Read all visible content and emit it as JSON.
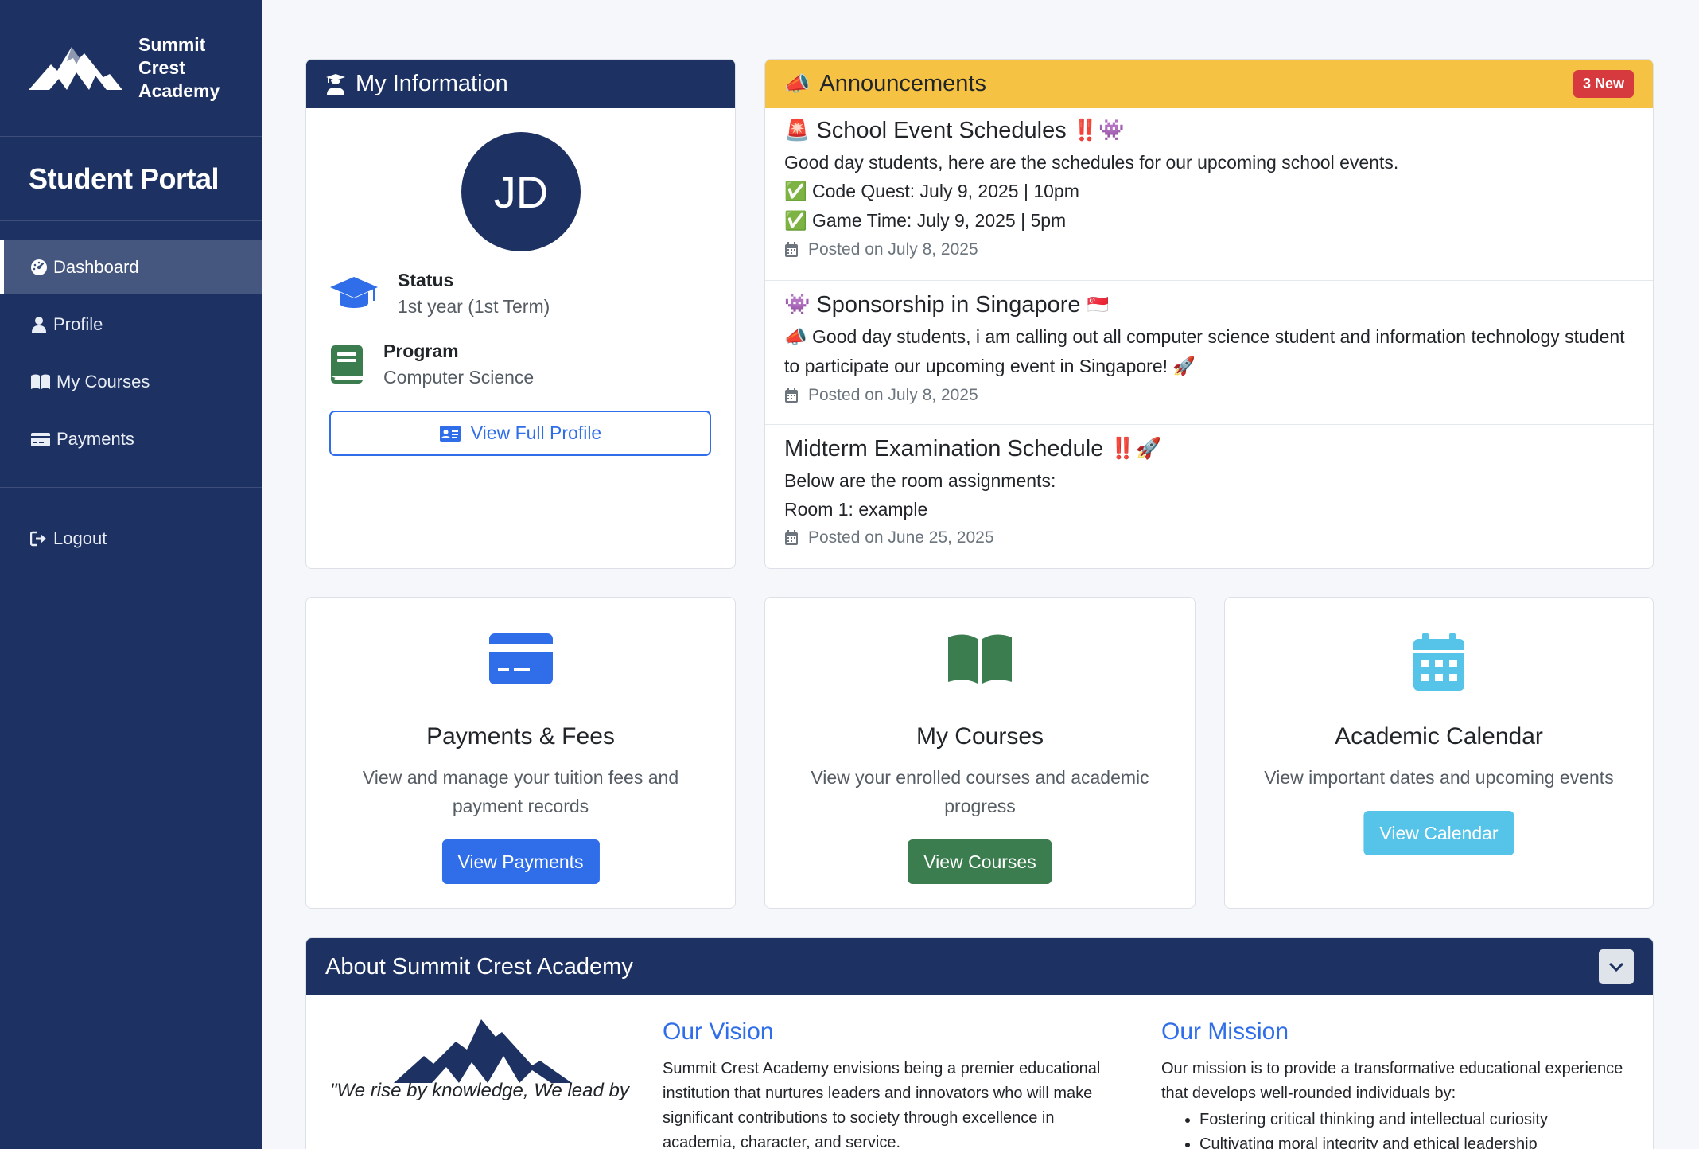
{
  "sidebar": {
    "brand_name": "Summit Crest Academy",
    "portal_title": "Student Portal",
    "items": [
      {
        "label": "Dashboard",
        "icon": "dashboard-icon"
      },
      {
        "label": "Profile",
        "icon": "user-icon"
      },
      {
        "label": "My Courses",
        "icon": "book-icon"
      },
      {
        "label": "Payments",
        "icon": "credit-card-icon"
      }
    ],
    "logout_label": "Logout"
  },
  "info_card": {
    "title": "My Information",
    "avatar_initials": "JD",
    "status_label": "Status",
    "status_value": "1st year (1st Term)",
    "program_label": "Program",
    "program_value": "Computer Science",
    "button_label": "View Full Profile"
  },
  "announcements": {
    "title": "Announcements",
    "badge": "3 New",
    "items": [
      {
        "title": "School Event Schedules",
        "title_prefix": "🚨",
        "title_suffix": "‼️👾",
        "body": "Good day students, here are the schedules for our upcoming school events.",
        "line1": "Code Quest: July 9, 2025 | 10pm",
        "line2": "Game Time: July 9, 2025 | 5pm",
        "line_icon": "✅",
        "date": "Posted on July 8, 2025"
      },
      {
        "title": "Sponsorship in Singapore",
        "title_prefix": "👾",
        "title_suffix": "🇸🇬",
        "body_prefix": "📣",
        "body": "Good day students, i am calling out all computer science student and information technology student to participate our upcoming event in Singapore!",
        "body_suffix": "🚀",
        "date": "Posted on July 8, 2025"
      },
      {
        "title": "Midterm Examination Schedule",
        "title_suffix": "‼️🚀",
        "body": "Below are the room assignments:",
        "line1": "Room 1: example",
        "date": "Posted on June 25, 2025"
      }
    ]
  },
  "quick_cards": [
    {
      "title": "Payments & Fees",
      "description": "View and manage your tuition fees and payment records",
      "button": "View Payments",
      "color": "#2f6ee8",
      "icon": "credit-card-icon"
    },
    {
      "title": "My Courses",
      "description": "View your enrolled courses and academic progress",
      "button": "View Courses",
      "color": "#3b7d4f",
      "icon": "open-book-icon"
    },
    {
      "title": "Academic Calendar",
      "description": "View important dates and upcoming events",
      "button": "View Calendar",
      "color": "#56c3e8",
      "icon": "calendar-icon"
    }
  ],
  "about": {
    "title": "About Summit Crest Academy",
    "quote": "\"We rise by knowledge, We lead by",
    "vision_title": "Our Vision",
    "vision_text": "Summit Crest Academy envisions being a premier educational institution that nurtures leaders and innovators who will make significant contributions to society through excellence in academia, character, and service.",
    "mission_title": "Our Mission",
    "mission_text": "Our mission is to provide a transformative educational experience that develops well-rounded individuals by:",
    "mission_points": [
      "Fostering critical thinking and intellectual curiosity",
      "Cultivating moral integrity and ethical leadership"
    ]
  },
  "colors": {
    "navy": "#1d3263",
    "announcement_yellow": "#f5c243",
    "badge_red": "#d63a3f",
    "primary_blue": "#2f6ee8"
  }
}
